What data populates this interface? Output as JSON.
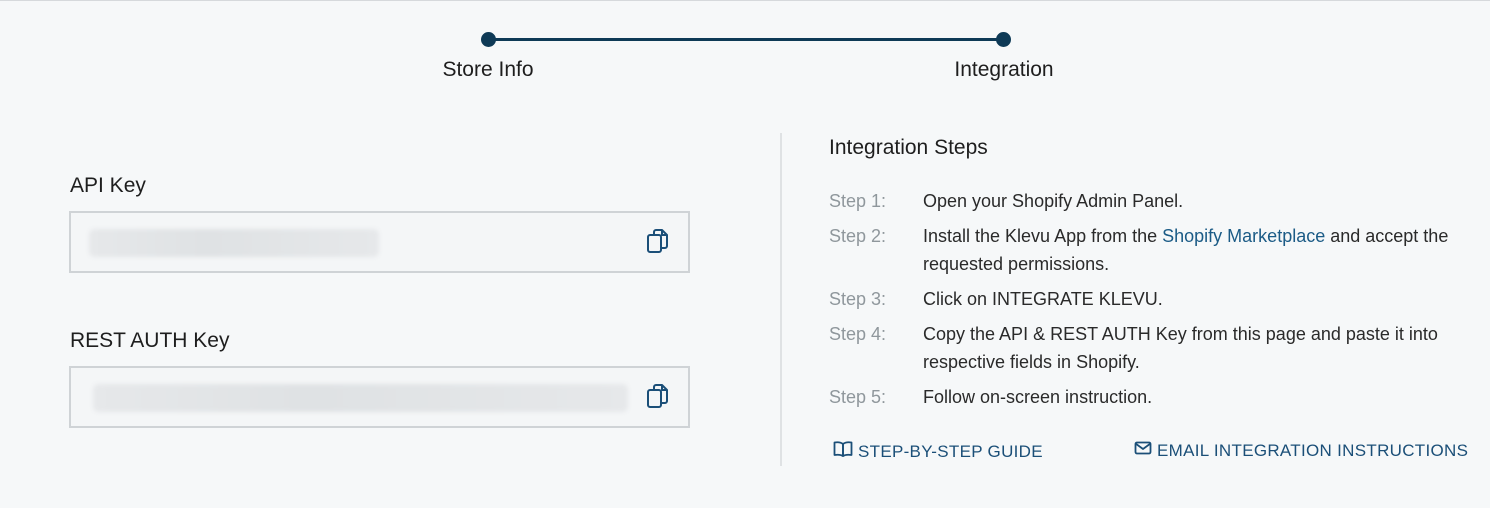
{
  "stepper": {
    "steps": [
      {
        "label": "Store Info"
      },
      {
        "label": "Integration"
      }
    ]
  },
  "fields": {
    "api_key": {
      "label": "API Key",
      "copy_icon": "copy-icon"
    },
    "rest_auth_key": {
      "label": "REST AUTH Key",
      "copy_icon": "copy-icon"
    }
  },
  "integration": {
    "title": "Integration Steps",
    "steps": [
      {
        "num": "Step 1:",
        "text": "Open your Shopify Admin Panel."
      },
      {
        "num": "Step 2:",
        "text_before": "Install the Klevu App from the ",
        "link": "Shopify Marketplace",
        "text_after": " and accept the requested permissions."
      },
      {
        "num": "Step 3:",
        "text": "Click on INTEGRATE KLEVU."
      },
      {
        "num": "Step 4:",
        "text": "Copy the API & REST AUTH Key from this page and paste it into respective fields in Shopify."
      },
      {
        "num": "Step 5:",
        "text": "Follow on-screen instruction."
      }
    ],
    "actions": {
      "guide": {
        "label": "STEP-BY-STEP GUIDE",
        "icon": "book-icon"
      },
      "email": {
        "label": "EMAIL INTEGRATION INSTRUCTIONS",
        "icon": "mail-icon"
      }
    }
  },
  "colors": {
    "accent": "#0e3a56",
    "link": "#1b5b86",
    "background": "#f6f8f9"
  }
}
